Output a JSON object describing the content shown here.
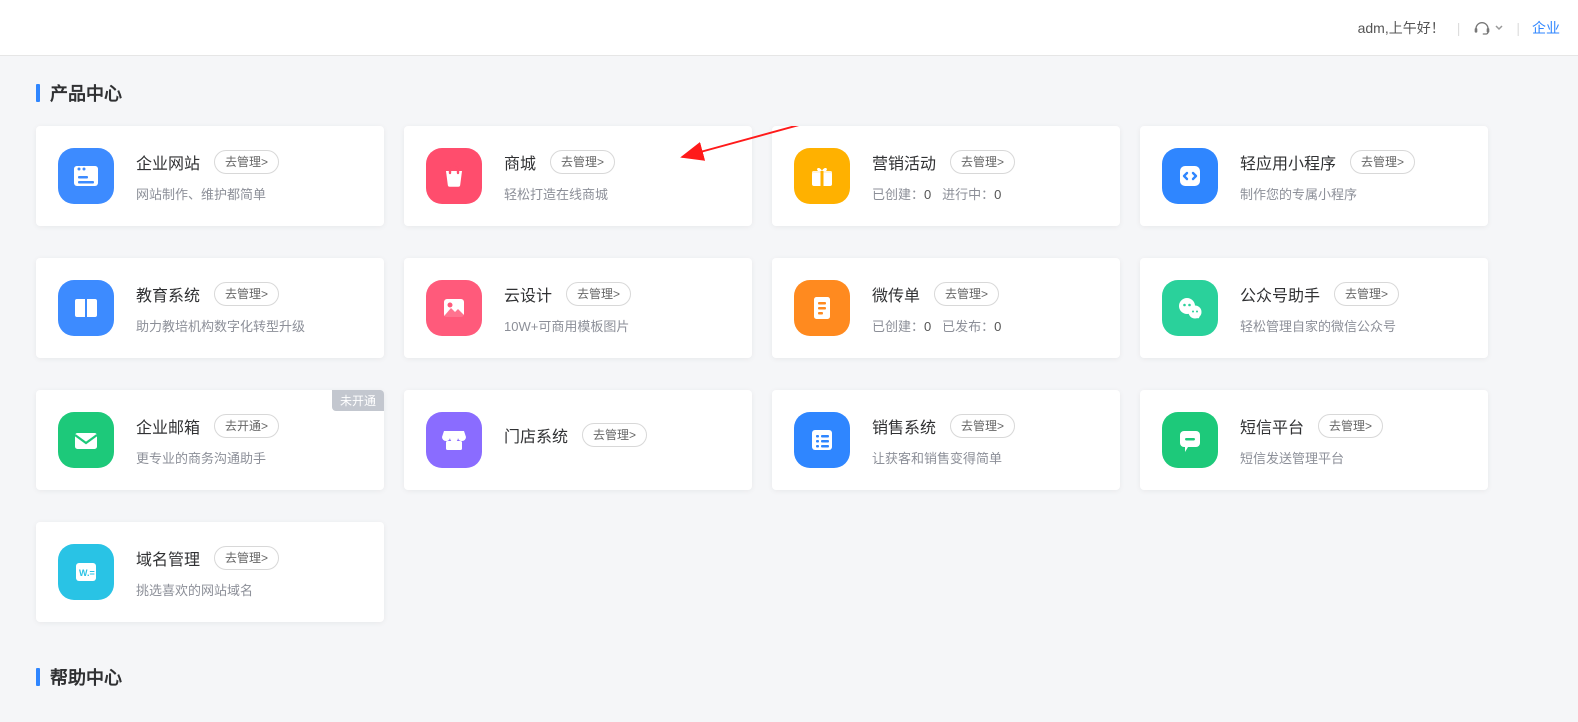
{
  "header": {
    "greeting": "adm,上午好！",
    "enterprise_link": "企业"
  },
  "section_title": "产品中心",
  "help_section_title": "帮助中心",
  "cards": [
    {
      "id": "website",
      "title": "企业网站",
      "btn": "去管理>",
      "sub": "网站制作、维护都简单",
      "bg": "#3d8bff",
      "icon": "browser"
    },
    {
      "id": "mall",
      "title": "商城",
      "btn": "去管理>",
      "sub": "轻松打造在线商城",
      "bg": "#ff4d6d",
      "icon": "bag"
    },
    {
      "id": "marketing",
      "title": "营销活动",
      "btn": "去管理>",
      "stats": [
        {
          "label": "已创建：",
          "value": "0"
        },
        {
          "label": "进行中：",
          "value": "0"
        }
      ],
      "bg": "#ffb100",
      "icon": "gift"
    },
    {
      "id": "miniapp",
      "title": "轻应用小程序",
      "btn": "去管理>",
      "sub": "制作您的专属小程序",
      "bg": "#2f86ff",
      "icon": "swap"
    },
    {
      "id": "edu",
      "title": "教育系统",
      "btn": "去管理>",
      "sub": "助力教培机构数字化转型升级",
      "bg": "#3d8bff",
      "icon": "book"
    },
    {
      "id": "design",
      "title": "云设计",
      "btn": "去管理>",
      "sub": "10W+可商用模板图片",
      "bg": "#ff5a7b",
      "icon": "image"
    },
    {
      "id": "leaflet",
      "title": "微传单",
      "btn": "去管理>",
      "stats": [
        {
          "label": "已创建：",
          "value": "0"
        },
        {
          "label": "已发布：",
          "value": "0"
        }
      ],
      "bg": "#ff8a1f",
      "icon": "page"
    },
    {
      "id": "wechat",
      "title": "公众号助手",
      "btn": "去管理>",
      "sub": "轻松管理自家的微信公众号",
      "bg": "#2ad19b",
      "icon": "wechat"
    },
    {
      "id": "mail",
      "title": "企业邮箱",
      "btn": "去开通>",
      "sub": "更专业的商务沟通助手",
      "bg": "#1dc97a",
      "icon": "mail",
      "badge": "未开通"
    },
    {
      "id": "store",
      "title": "门店系统",
      "btn": "去管理>",
      "sub": "",
      "bg": "#8a6cff",
      "icon": "store"
    },
    {
      "id": "sales",
      "title": "销售系统",
      "btn": "去管理>",
      "sub": "让获客和销售变得简单",
      "bg": "#2f86ff",
      "icon": "list"
    },
    {
      "id": "sms",
      "title": "短信平台",
      "btn": "去管理>",
      "sub": "短信发送管理平台",
      "bg": "#1dc97a",
      "icon": "chat"
    },
    {
      "id": "domain",
      "title": "域名管理",
      "btn": "去管理>",
      "sub": "挑选喜欢的网站域名",
      "bg": "#29c3e5",
      "icon": "domain"
    }
  ]
}
